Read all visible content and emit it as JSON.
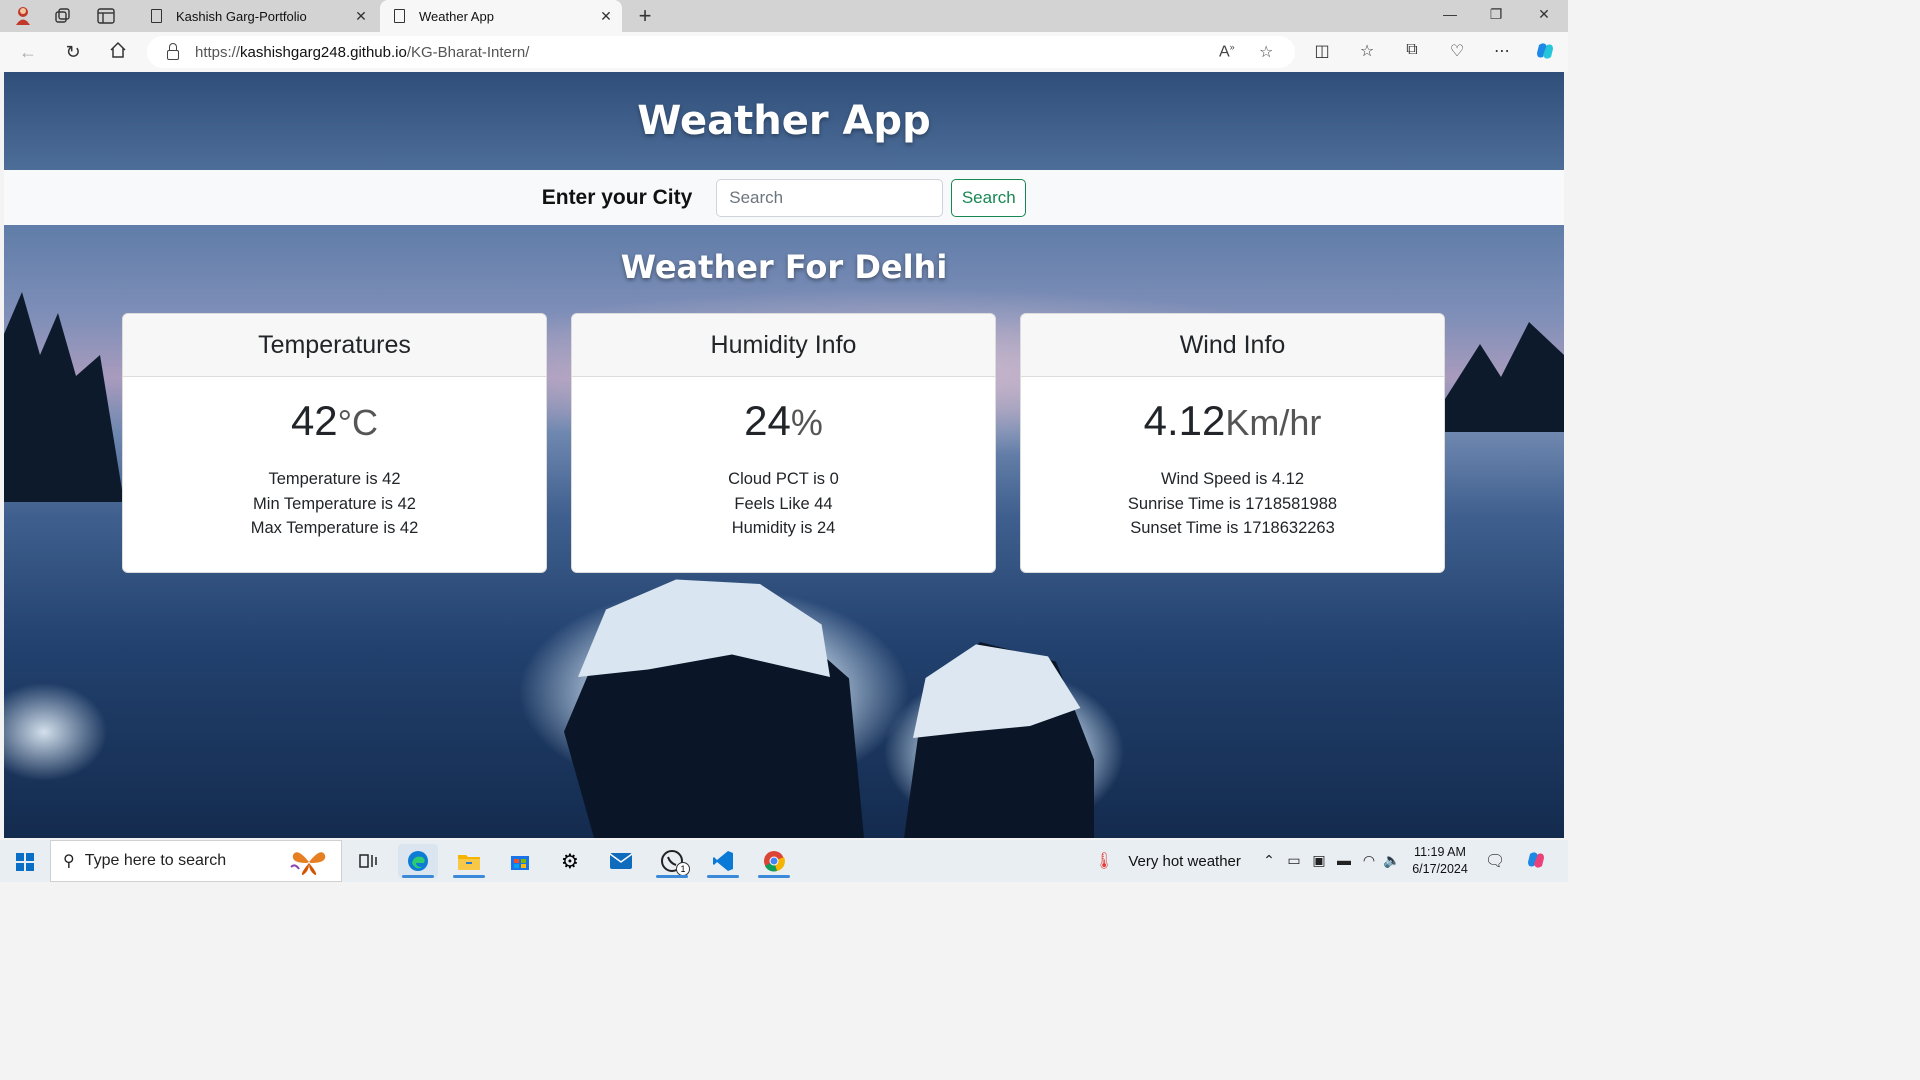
{
  "browser": {
    "tabs": [
      {
        "title": "Kashish Garg-Portfolio",
        "active": false
      },
      {
        "title": "Weather App",
        "active": true
      }
    ],
    "url_host": "kashishgarg248.github.io",
    "url_prefix": "https://",
    "url_path": "/KG-Bharat-Intern/"
  },
  "app": {
    "title": "Weather App",
    "search_label": "Enter your City",
    "search_placeholder": "Search",
    "search_button": "Search",
    "heading": "Weather For Delhi"
  },
  "cards": [
    {
      "header": "Temperatures",
      "value": "42",
      "unit": "°C",
      "lines": [
        "Temperature is 42",
        "Min Temperature is 42",
        "Max Temperature is 42"
      ]
    },
    {
      "header": "Humidity Info",
      "value": "24",
      "unit": "%",
      "lines": [
        "Cloud PCT is 0",
        "Feels Like 44",
        "Humidity is 24"
      ]
    },
    {
      "header": "Wind Info",
      "value": "4.12",
      "unit": "Km/hr",
      "lines": [
        "Wind Speed is 4.12",
        "Sunrise Time is 1718581988",
        "Sunset Time is 1718632263"
      ]
    }
  ],
  "taskbar": {
    "search_placeholder": "Type here to search",
    "weather_text": "Very hot weather",
    "time": "11:19 AM",
    "date": "6/17/2024",
    "whatsapp_badge": "1"
  },
  "colors": {
    "success": "#198754",
    "accent": "#0b6fc8"
  }
}
